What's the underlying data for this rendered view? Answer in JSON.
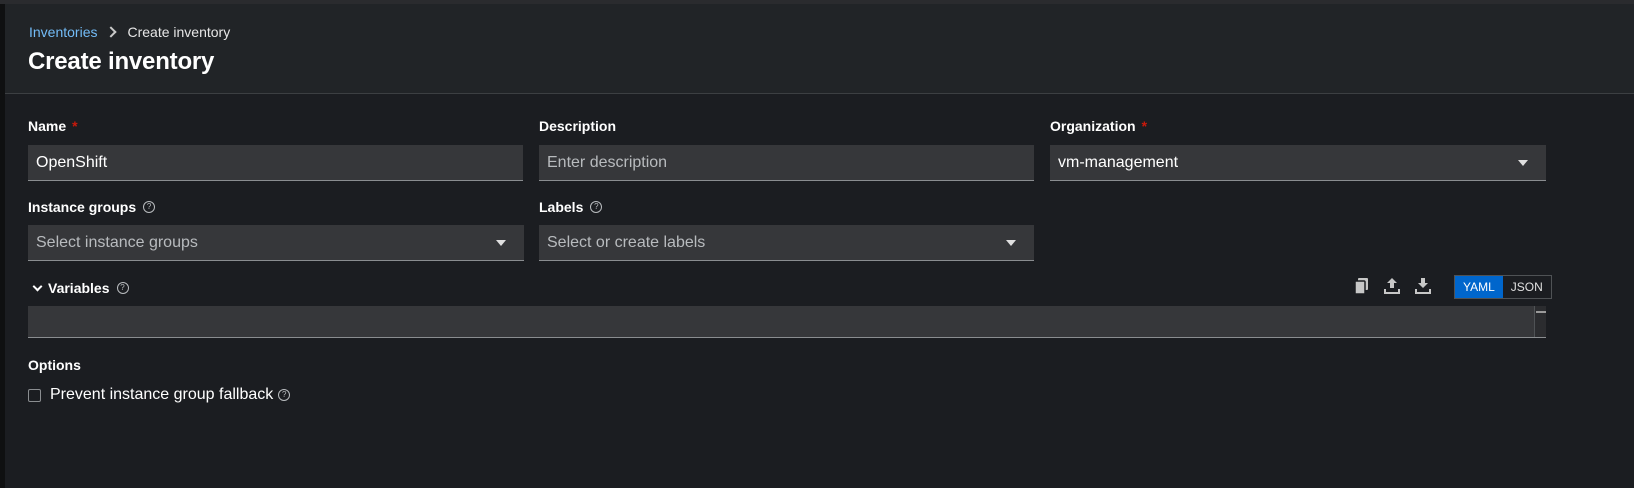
{
  "breadcrumb": {
    "parent": "Inventories",
    "current": "Create inventory"
  },
  "page": {
    "title": "Create inventory"
  },
  "form": {
    "name": {
      "label": "Name",
      "required_mark": "*",
      "value": "OpenShift"
    },
    "description": {
      "label": "Description",
      "placeholder": "Enter description",
      "value": ""
    },
    "organization": {
      "label": "Organization",
      "required_mark": "*",
      "value": "vm-management"
    },
    "instance_groups": {
      "label": "Instance groups",
      "placeholder": "Select instance groups",
      "help_icon": "?"
    },
    "labels": {
      "label": "Labels",
      "placeholder": "Select or create labels",
      "help_icon": "?"
    },
    "variables": {
      "label": "Variables",
      "help_icon": "?",
      "expanded": true,
      "content": "",
      "format_options": [
        "YAML",
        "JSON"
      ],
      "selected_format": "YAML",
      "tools": [
        "copy-icon",
        "upload-icon",
        "download-icon"
      ]
    },
    "options": {
      "label": "Options",
      "prevent_fallback": {
        "label": "Prevent instance group fallback",
        "checked": false,
        "help_icon": "?"
      }
    }
  },
  "colors": {
    "accent": "#0066cc",
    "link": "#73bcf7",
    "required": "#c9190b",
    "background": "#1b1d21",
    "header_bg": "#212427",
    "input_bg": "#36373a"
  }
}
